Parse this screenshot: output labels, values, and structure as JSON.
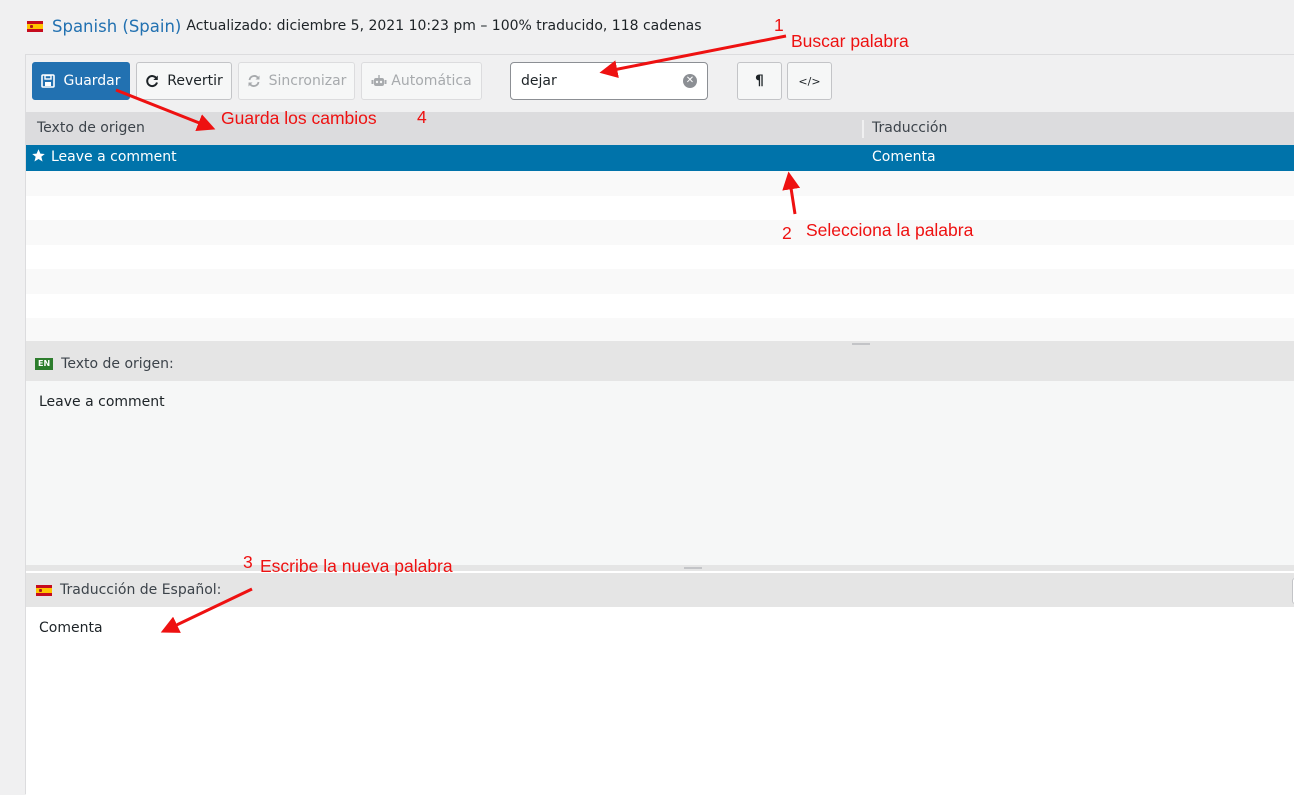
{
  "header": {
    "language": "Spanish (Spain)",
    "meta": "Actualizado: diciembre 5, 2021 10:23 pm – 100% traducido, 118 cadenas"
  },
  "toolbar": {
    "save_label": "Guardar",
    "revert_label": "Revertir",
    "sync_label": "Sincronizar",
    "auto_label": "Automática",
    "search_value": "dejar",
    "pilcrow_label": "¶",
    "code_label": "</>"
  },
  "grid": {
    "source_header": "Texto de origen",
    "target_header": "Traducción",
    "rows": [
      {
        "source": "Leave a comment",
        "target": "Comenta",
        "selected": true
      }
    ]
  },
  "source_pane": {
    "badge": "EN",
    "label": "Texto de origen:",
    "text": "Leave a comment"
  },
  "target_pane": {
    "label": "Traducción de Español:",
    "text": "Comenta"
  },
  "annotations": {
    "n1": "1",
    "search_word": "Buscar palabra",
    "save_changes": "Guarda los cambios",
    "n4": "4",
    "n2": "2",
    "select_word": "Selecciona la palabra",
    "n3": "3",
    "write_new": "Escribe la nueva palabra",
    "arrow_color": "#ee1111"
  },
  "colors": {
    "primary": "#2271b1",
    "selected_row": "#0073aa",
    "link": "#2271b1"
  }
}
